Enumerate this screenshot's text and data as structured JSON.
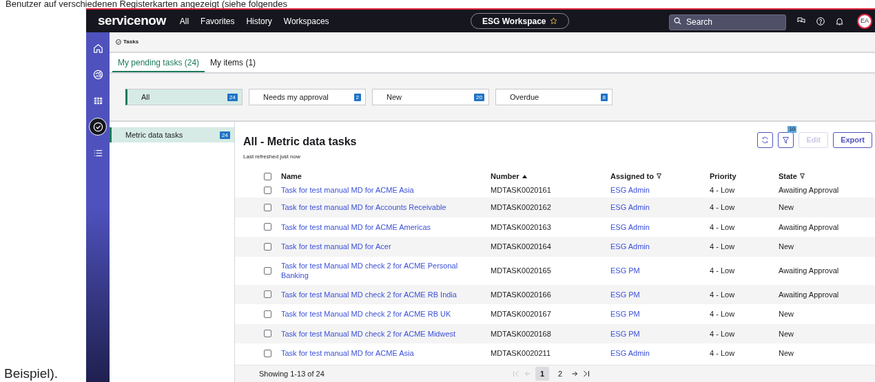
{
  "document_text": {
    "top": "Benutzer auf verschiedenen Registerkarten angezeigt (siehe folgendes",
    "bottom": "Beispiel)."
  },
  "nav": {
    "logo": "servicenow",
    "menu": [
      "All",
      "Favorites",
      "History",
      "Workspaces"
    ],
    "workspace": "ESG Workspace",
    "search": {
      "placeholder": "Search"
    },
    "avatar": "EA"
  },
  "sidebar": {
    "items": [
      {
        "kind": "home",
        "selected": false
      },
      {
        "kind": "gauge",
        "selected": false
      },
      {
        "kind": "table",
        "selected": false
      },
      {
        "kind": "check",
        "selected": true
      },
      {
        "kind": "list",
        "selected": false
      }
    ]
  },
  "breadcrumb": "Tasks",
  "tabs": [
    {
      "label": "My pending tasks (24)",
      "selected": true
    },
    {
      "label": "My items (1)",
      "selected": false
    }
  ],
  "filters": [
    {
      "label": "All",
      "count": "24",
      "selected": true
    },
    {
      "label": "Needs my approval",
      "count": "2",
      "selected": false
    },
    {
      "label": "New",
      "count": "20",
      "selected": false
    },
    {
      "label": "Overdue",
      "count": "8",
      "selected": false
    }
  ],
  "categories": [
    {
      "label": "Metric data tasks",
      "count": "24",
      "selected": true
    }
  ],
  "list": {
    "title": "All - Metric data tasks",
    "subtitle": "Last refreshed just now",
    "filter_count": "10",
    "buttons": [
      {
        "label": "Edit",
        "disabled": true
      },
      {
        "label": "Export",
        "disabled": false
      }
    ],
    "select_all_checked": false,
    "columns": [
      {
        "label": "Name",
        "sorted_ascending": false,
        "filter": false
      },
      {
        "label": "Number",
        "sorted_ascending": true,
        "filter": false
      },
      {
        "label": "Assigned to",
        "sorted_ascending": false,
        "filter": true
      },
      {
        "label": "Priority",
        "sorted_ascending": false,
        "filter": false
      },
      {
        "label": "State",
        "sorted_ascending": false,
        "filter": true
      }
    ],
    "rows": [
      {
        "name": "Task for test manual MD for ACME Asia",
        "number": "MDTASK0020161",
        "assigned_to": "ESG Admin",
        "priority": "4 - Low",
        "state": "Awaiting Approval",
        "checked": false
      },
      {
        "name": "Task for test manual MD for Accounts Receivable",
        "number": "MDTASK0020162",
        "assigned_to": "ESG Admin",
        "priority": "4 - Low",
        "state": "New",
        "checked": false
      },
      {
        "name": "Task for test manual MD for ACME Americas",
        "number": "MDTASK0020163",
        "assigned_to": "ESG Admin",
        "priority": "4 - Low",
        "state": "Awaiting Approval",
        "checked": false
      },
      {
        "name": "Task for test manual MD for Acer",
        "number": "MDTASK0020164",
        "assigned_to": "ESG Admin",
        "priority": "4 - Low",
        "state": "New",
        "checked": false
      },
      {
        "name": "Task for test Manual MD check 2 for ACME Personal Banking",
        "number": "MDTASK0020165",
        "assigned_to": "ESG PM",
        "priority": "4 - Low",
        "state": "Awaiting Approval",
        "checked": false
      },
      {
        "name": "Task for test Manual MD check 2 for ACME RB India",
        "number": "MDTASK0020166",
        "assigned_to": "ESG PM",
        "priority": "4 - Low",
        "state": "Awaiting Approval",
        "checked": false
      },
      {
        "name": "Task for test Manual MD check 2 for ACME RB UK",
        "number": "MDTASK0020167",
        "assigned_to": "ESG PM",
        "priority": "4 - Low",
        "state": "New",
        "checked": false
      },
      {
        "name": "Task for test Manual MD check 2 for ACME Midwest",
        "number": "MDTASK0020168",
        "assigned_to": "ESG PM",
        "priority": "4 - Low",
        "state": "New",
        "checked": false
      },
      {
        "name": "Task for test manual MD for ACME Asia",
        "number": "MDTASK0020211",
        "assigned_to": "ESG Admin",
        "priority": "4 - Low",
        "state": "New",
        "checked": false
      }
    ],
    "footer": "Showing 1-13 of 24",
    "pager": [
      {
        "kind": "first",
        "disabled": true
      },
      {
        "kind": "prev",
        "disabled": true
      },
      {
        "kind": "page",
        "label": "1",
        "selected": true
      },
      {
        "kind": "page",
        "label": "2",
        "selected": false
      },
      {
        "kind": "next",
        "disabled": false
      },
      {
        "kind": "last",
        "disabled": false
      }
    ]
  }
}
